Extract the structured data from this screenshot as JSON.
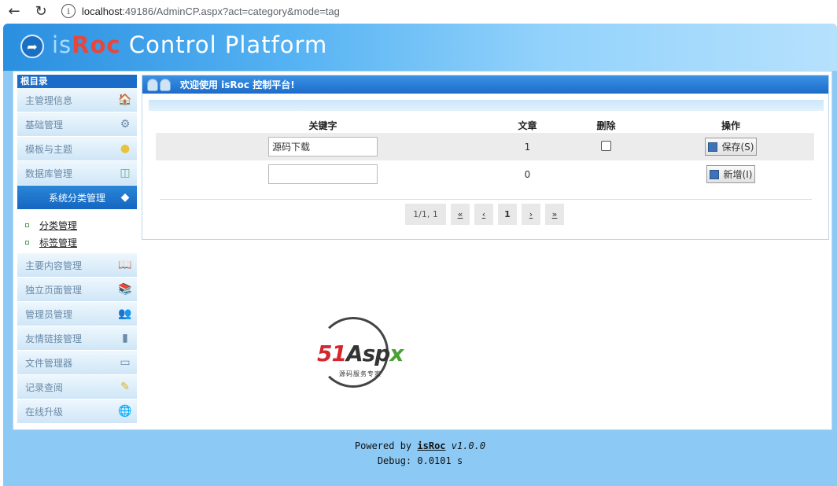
{
  "browser": {
    "url_host": "localhost",
    "url_rest": ":49186/AdminCP.aspx?act=category&mode=tag"
  },
  "header": {
    "logo_is": "is",
    "logo_roc": "Roc",
    "logo_rest": " Control Platform"
  },
  "sidebar": {
    "root": "根目录",
    "items": [
      {
        "label": "主管理信息",
        "icon": "home-icon"
      },
      {
        "label": "基础管理",
        "icon": "tools-icon"
      },
      {
        "label": "模板与主题",
        "icon": "lightbulb-icon"
      },
      {
        "label": "数据库管理",
        "icon": "database-icon"
      },
      {
        "label": "系统分类管理",
        "icon": "tag-icon"
      },
      {
        "label": "主要内容管理",
        "icon": "book-icon"
      },
      {
        "label": "独立页面管理",
        "icon": "books-icon"
      },
      {
        "label": "管理员管理",
        "icon": "users-icon"
      },
      {
        "label": "友情链接管理",
        "icon": "battery-icon"
      },
      {
        "label": "文件管理器",
        "icon": "file-icon"
      },
      {
        "label": "记录查阅",
        "icon": "pencil-icon"
      },
      {
        "label": "在线升级",
        "icon": "globe-icon"
      }
    ],
    "sub_items": [
      {
        "label": "分类管理"
      },
      {
        "label": "标签管理"
      }
    ]
  },
  "main": {
    "title": "欢迎使用 isRoc 控制平台!",
    "columns": [
      "关键字",
      "文章",
      "删除",
      "操作"
    ],
    "rows": [
      {
        "keyword": "源码下载",
        "articles": "1",
        "has_delete": true,
        "action": "保存(S)"
      },
      {
        "keyword": "",
        "articles": "0",
        "has_delete": false,
        "action": "新增(I)"
      }
    ],
    "pager": {
      "info": "1/1, 1",
      "first": "«",
      "prev": "‹",
      "current": "1",
      "next": "›",
      "last": "»"
    }
  },
  "watermark": {
    "n51": "51",
    "aspx_a": "Asp",
    "aspx_x": "x",
    "tagline": "源码服务专家"
  },
  "footer": {
    "powered_prefix": "Powered by ",
    "brand": "isRoc",
    "version": " v1.0.0",
    "debug": "Debug: 0.0101 s"
  }
}
